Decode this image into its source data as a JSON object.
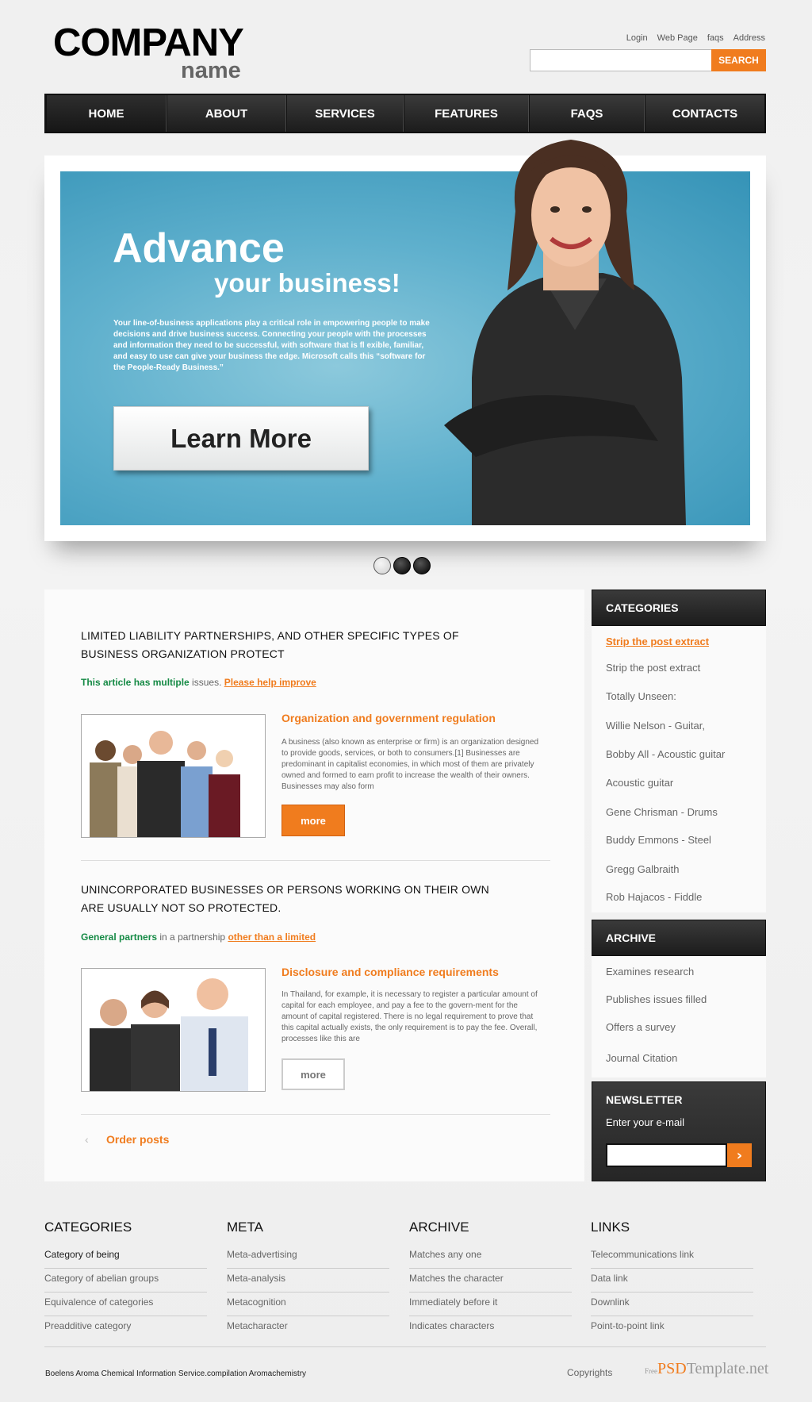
{
  "header": {
    "logo_main": "COMPANY",
    "logo_sub": "name",
    "top_links": [
      "Login",
      "Web Page",
      "faqs",
      "Address"
    ],
    "search_button": "SEARCH"
  },
  "nav": [
    "HOME",
    "ABOUT",
    "SERVICES",
    "FEATURES",
    "FAQS",
    "CONTACTS"
  ],
  "hero": {
    "title": "Advance",
    "subtitle": "your business!",
    "text": "Your line-of-business applications play a critical role in empowering people to make decisions and drive business success. Connecting your people with the processes and information they need to be successful, with software that is fl exible, familiar, and easy to use can give your business the edge. Microsoft calls this “software for the People-Ready Business.”",
    "button": "Learn More"
  },
  "articles": [
    {
      "heading_line1": "LIMITED LIABILITY PARTNERSHIPS, AND OTHER SPECIFIC TYPES OF",
      "heading_line2": "BUSINESS ORGANIZATION PROTECT",
      "meta_green": "This article has multiple",
      "meta_grey": " issues. ",
      "meta_link": "Please help improve",
      "title": "Organization and government regulation",
      "text": "A business (also known as enterprise or firm) is an organization designed to provide goods, services, or both to consumers.[1] Businesses are predominant in capitalist economies, in which most of them are privately owned and formed to earn profit to increase the wealth of their owners. Businesses may also form",
      "more": "more"
    },
    {
      "heading_line1": "UNINCORPORATED BUSINESSES OR PERSONS WORKING ON THEIR OWN",
      "heading_line2": "ARE USUALLY NOT SO PROTECTED.",
      "meta_green": "General partners",
      "meta_grey": " in a partnership ",
      "meta_link": "other than a limited",
      "title": "Disclosure and compliance requirements",
      "text": "In Thailand, for example, it is necessary to register a particular amount of capital for each employee, and pay a fee to the govern-ment for the amount of capital registered. There is no legal requirement to prove that this capital actually exists, the only requirement is to pay the fee. Overall, processes like this are",
      "more": "more"
    }
  ],
  "order_posts": "Order posts",
  "prev_icon": "‹",
  "sidebar": {
    "categories_title": "CATEGORIES",
    "categories": [
      "Strip the post extract",
      "Strip the post extract",
      "Totally Unseen:",
      "Willie Nelson - Guitar,",
      "Bobby All - Acoustic guitar",
      "Acoustic guitar",
      "Gene Chrisman - Drums",
      "Buddy Emmons - Steel",
      "Gregg Galbraith",
      "Rob Hajacos - Fiddle"
    ],
    "archive_title": "ARCHIVE",
    "archive": [
      "Examines research",
      "Publishes issues filled",
      "Offers a survey",
      "Journal Citation"
    ],
    "newsletter_title": "NEWSLETTER",
    "newsletter_label": "Enter your e-mail",
    "newsletter_button": "›"
  },
  "footer": {
    "columns": [
      {
        "title": "CATEGORIES",
        "links": [
          "Category of being",
          "Category of abelian groups",
          "Equivalence of categories",
          "Preadditive category"
        ]
      },
      {
        "title": "META",
        "links": [
          "Meta-advertising",
          "Meta-analysis",
          "Metacognition",
          "Metacharacter"
        ]
      },
      {
        "title": "ARCHIVE",
        "links": [
          "Matches any one",
          "Matches the character",
          "Immediately before it",
          "Indicates characters"
        ]
      },
      {
        "title": "LINKS",
        "links": [
          "Telecommunications link",
          "Data link",
          "Downlink",
          "Point-to-point link"
        ]
      }
    ],
    "copy_left": "Boelens Aroma Chemical Information Service.compilation Aromachemistry",
    "copyrights": "Copyrights",
    "brand_prefix": "Free",
    "brand_psd": "PSD",
    "brand_rest": "Template.net"
  },
  "colors": {
    "accent": "#f07c1e",
    "green": "#158a45",
    "hero_blue": "#5fb0cd",
    "nav_dark": "#1c1c1c"
  }
}
